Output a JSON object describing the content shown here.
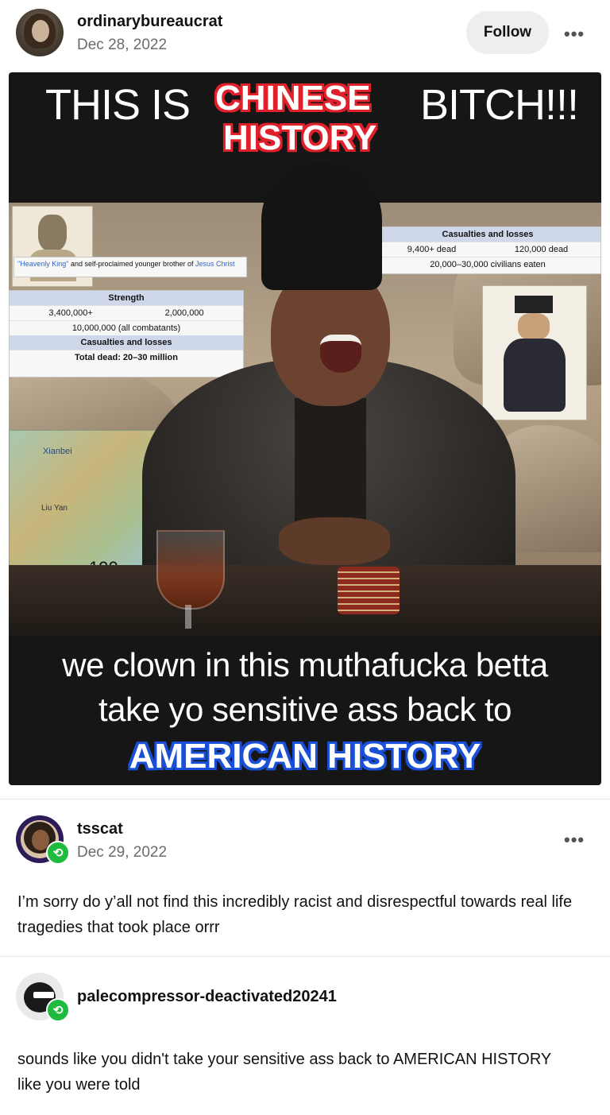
{
  "post": {
    "username": "ordinarybureaucrat",
    "date": "Dec 28, 2022",
    "follow_label": "Follow",
    "more_label": "•••"
  },
  "meme": {
    "top_white_1": "THIS IS",
    "top_red": "CHINESE",
    "top_white_2": "BITCH!!!",
    "top_red_2": "HISTORY",
    "bottom_line_1": "we clown in this muthafucka betta",
    "bottom_line_2": "take yo sensitive ass back to",
    "bottom_blue": "AMERICAN HISTORY",
    "wiki_left": {
      "caption_blue": "\"Heavenly King\"",
      "caption": " and self-proclaimed younger brother of ",
      "caption_blue_2": "Jesus Christ",
      "strength_head": "Strength",
      "strength_a": "3,400,000+",
      "strength_b": "2,000,000",
      "combatants": "10,000,000 (all combatants)",
      "casualties_head": "Casualties and losses",
      "total_dead": "Total dead: 20–30 million"
    },
    "wiki_right": {
      "head": "Casualties and losses",
      "a": "9,400+ dead",
      "b": "120,000 dead",
      "c": "20,000–30,000 civilians eaten"
    },
    "map": {
      "number": "190",
      "label_1": "Xianbei",
      "label_2": "Liu Yan"
    }
  },
  "reblogs": [
    {
      "username": "tsscat",
      "date": "Dec 29, 2022",
      "more_label": "•••",
      "text": "I’m sorry do y’all not find this incredibly racist and disrespectful towards real life tragedies that took place orrr"
    },
    {
      "username": "palecompressor-deactivated20241",
      "text": "sounds like you didn't take your sensitive ass back to AMERICAN HISTORY like you were told"
    }
  ],
  "colors": {
    "reblog_green": "#1fbb3e",
    "red_caption": "#e0202a",
    "blue_caption": "#1a4fd8"
  },
  "icons": {
    "reblog": "reblog-icon",
    "more": "more-icon"
  }
}
